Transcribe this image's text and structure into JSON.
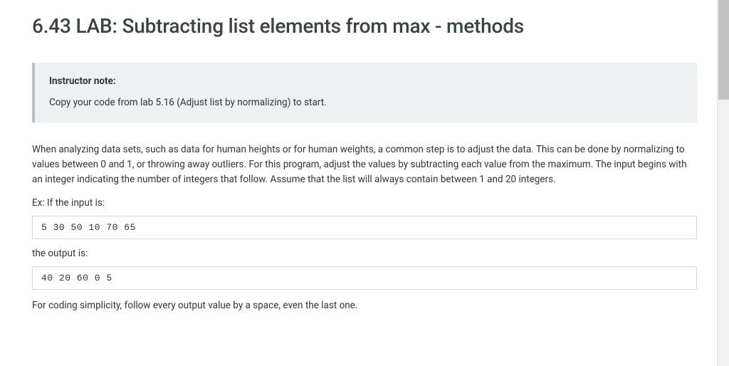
{
  "title": "6.43 LAB: Subtracting list elements from max - methods",
  "instructor_note": {
    "label": "Instructor note:",
    "text": "Copy your code from lab 5.16 (Adjust list by normalizing) to start."
  },
  "paragraph_intro": "When analyzing data sets, such as data for human heights or for human weights, a common step is to adjust the data. This can be done by normalizing to values between 0 and 1, or throwing away outliers. For this program, adjust the values by subtracting each value from the maximum. The input begins with an integer indicating the number of integers that follow. Assume that the list will always contain between 1 and 20 integers.",
  "example_prefix": "Ex: If the input is:",
  "example_input": "5 30 50 10 70 65",
  "output_label": "the output is:",
  "example_output": "40 20 60 0 5",
  "paragraph_footer": "For coding simplicity, follow every output value by a space, even the last one."
}
